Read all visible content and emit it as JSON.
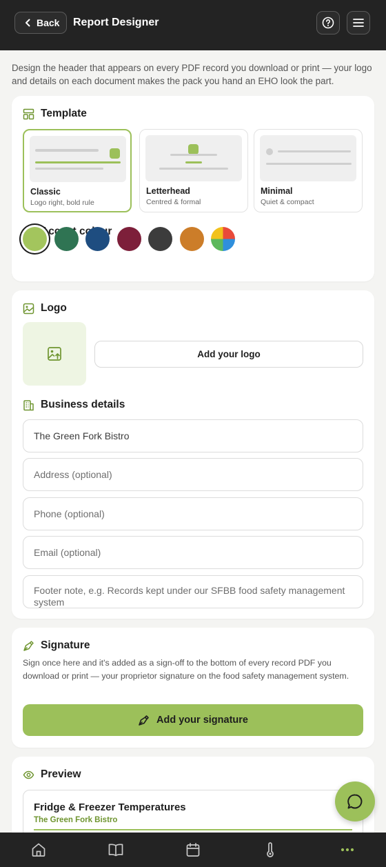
{
  "header": {
    "back_label": "Back",
    "title": "Report Designer",
    "help_icon": "question-circle-icon",
    "menu_icon": "hamburger-menu-icon"
  },
  "intro": "Design the header that appears on every PDF record you download or print — your logo and details on each document makes the pack you hand an EHO look the part.",
  "template": {
    "heading": "Template",
    "options": [
      {
        "name": "Classic",
        "desc": "Logo right, bold rule",
        "selected": true
      },
      {
        "name": "Letterhead",
        "desc": "Centred & formal",
        "selected": false
      },
      {
        "name": "Minimal",
        "desc": "Quiet & compact",
        "selected": false
      }
    ]
  },
  "accent": {
    "heading": "Accent colour",
    "swatches": [
      "#a3c55d",
      "#2f7453",
      "#1e4d80",
      "#7d1f3a",
      "#3c3c3c",
      "#cc7d29",
      "multicolor"
    ],
    "selected_index": 0
  },
  "logo": {
    "heading": "Logo",
    "add_label": "Add your logo"
  },
  "business": {
    "heading": "Business details",
    "name_value": "The Green Fork Bistro",
    "address_placeholder": "Address (optional)",
    "phone_placeholder": "Phone (optional)",
    "email_placeholder": "Email (optional)",
    "footer_placeholder": "Footer note, e.g. Records kept under our SFBB food safety management system"
  },
  "signature": {
    "heading": "Signature",
    "description": "Sign once here and it's added as a sign-off to the bottom of every record PDF you download or print — your proprietor signature on the food safety management system.",
    "button_label": "Add your signature"
  },
  "preview": {
    "heading": "Preview",
    "doc_title": "Fridge & Freezer Temperatures",
    "business_name": "The Green Fork Bistro"
  },
  "fab_icon": "chat-bubble-icon",
  "bottom_nav": [
    "home-icon",
    "book-icon",
    "calendar-icon",
    "thermometer-icon",
    "more-dots-icon"
  ],
  "colors": {
    "accent": "#9cc05a",
    "dark_bar": "#232323",
    "background": "#f4f4f2"
  }
}
